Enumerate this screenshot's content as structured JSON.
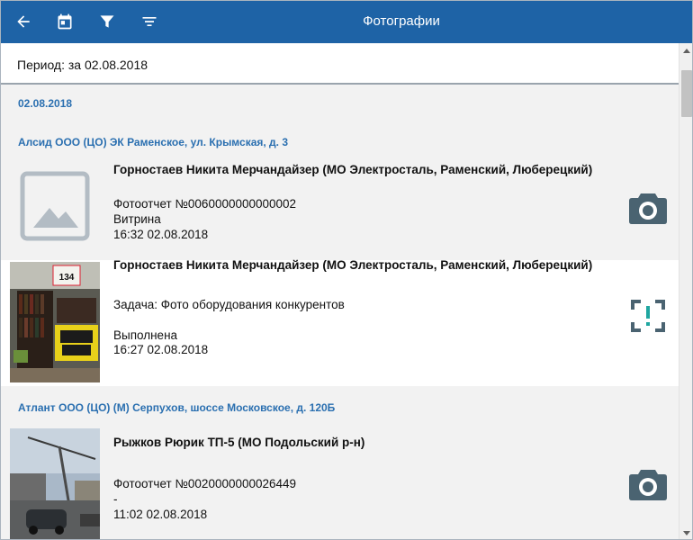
{
  "toolbar": {
    "title": "Фотографии",
    "icons": [
      "back-arrow-icon",
      "calendar-icon",
      "filter-icon",
      "sort-icon"
    ],
    "color": "#1e63a6"
  },
  "period": {
    "label": "Период: за 02.08.2018"
  },
  "groups": [
    {
      "date": "02.08.2018",
      "stores": [
        {
          "name": "Алсид ООО (ЦО) ЭК Раменское, ул. Крымская, д. 3",
          "items": [
            {
              "author": "Горностаев Никита Мерчандайзер (МО Электросталь, Раменский, Люберецкий)",
              "line2": "Фотоотчет №0060000000000002",
              "line3": "Витрина",
              "time": "16:32 02.08.2018",
              "thumbnail": "placeholder-image",
              "action_icon": "camera-icon"
            },
            {
              "author": "Горностаев Никита Мерчандайзер (МО Электросталь, Раменский, Люберецкий)",
              "line2": "Задача: Фото оборудования конкурентов",
              "line3": "Выполнена",
              "time": "16:27 02.08.2018",
              "thumbnail": "store-shelf-photo",
              "thumb_text": "134",
              "action_icon": "scan-alert-icon"
            }
          ]
        },
        {
          "name": "Атлант ООО (ЦО) (М) Серпухов, шоссе Московское, д. 120Б",
          "items": [
            {
              "author": "Рыжков Рюрик ТП-5 (МО Подольский р-н)",
              "line2": "Фотоотчет №0020000000026449",
              "line3": "-",
              "time": "11:02 02.08.2018",
              "thumbnail": "street-photo",
              "action_icon": "camera-icon"
            }
          ]
        }
      ]
    }
  ]
}
